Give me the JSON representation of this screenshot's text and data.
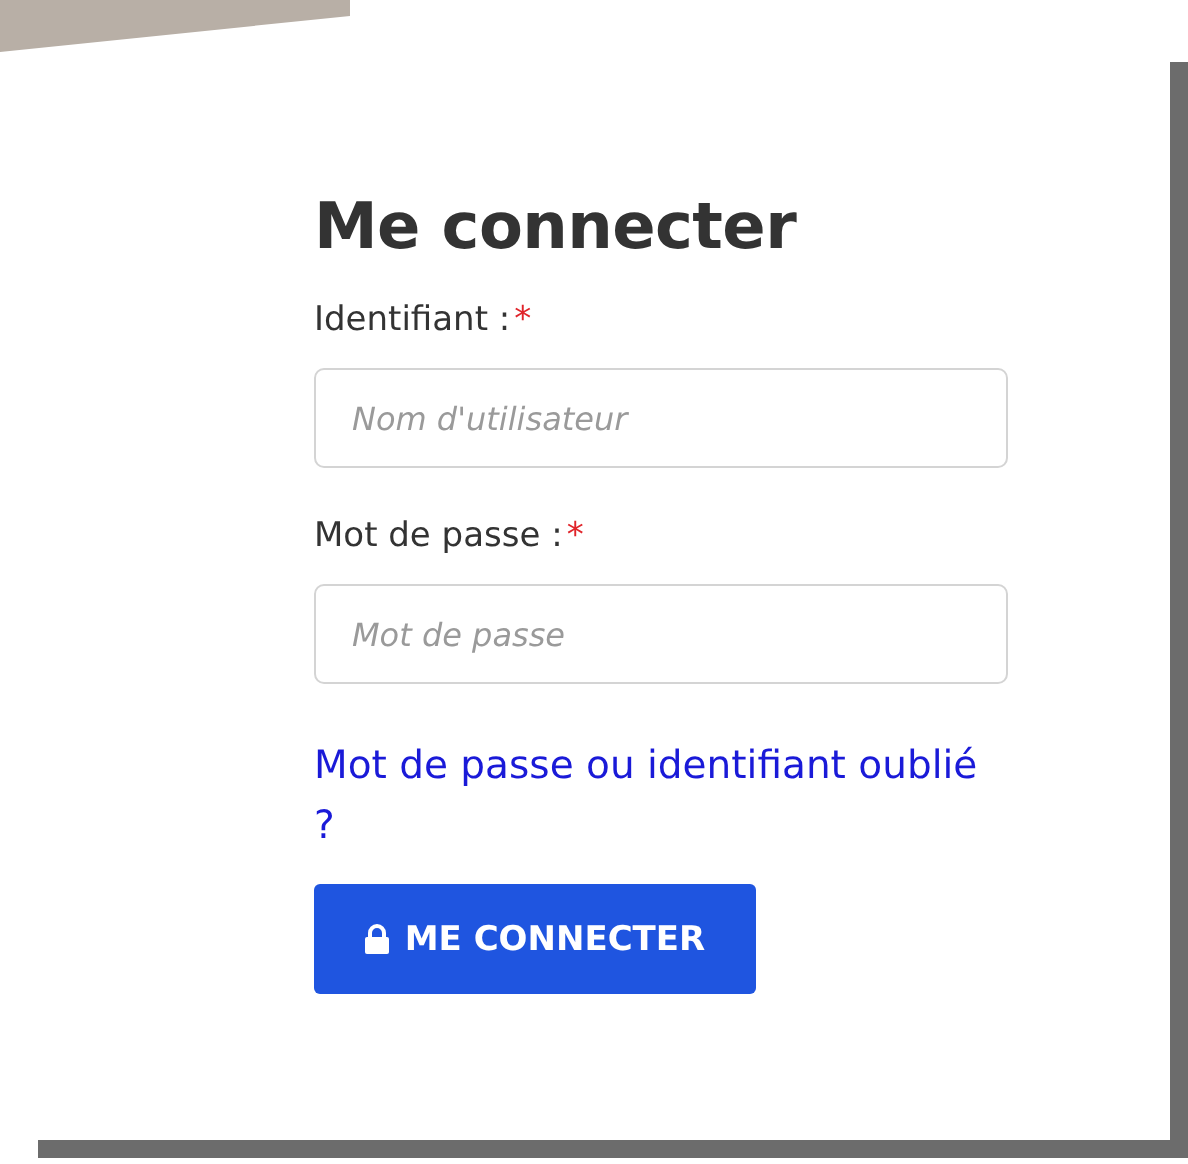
{
  "title": "Me connecter",
  "fields": [
    {
      "label": "Identifiant :",
      "required_mark": "*",
      "placeholder": "Nom d'utilisateur"
    },
    {
      "label": "Mot de passe :",
      "required_mark": "*",
      "placeholder": "Mot de passe"
    }
  ],
  "forgot_link": "Mot de passe ou identifiant oublié ?",
  "submit_button": "ME CONNECTER"
}
